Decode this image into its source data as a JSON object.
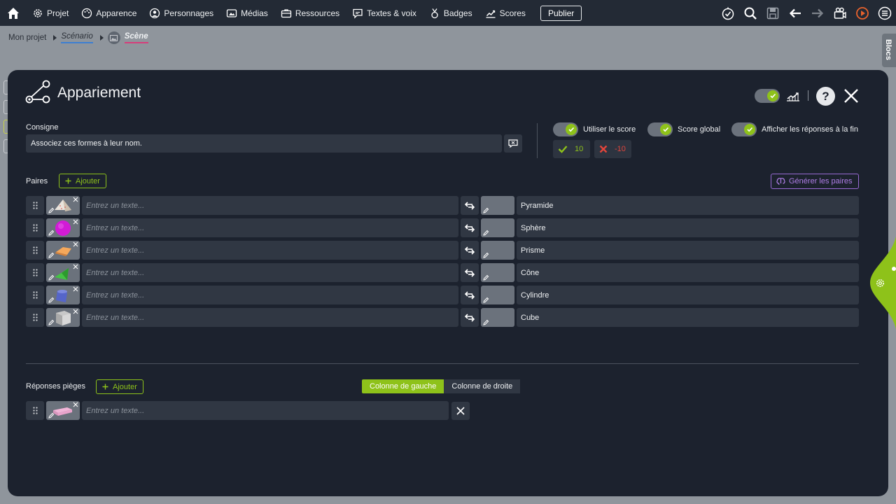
{
  "nav": {
    "items": [
      {
        "label": "Projet",
        "icon": "gear-icon"
      },
      {
        "label": "Apparence",
        "icon": "palette-icon"
      },
      {
        "label": "Personnages",
        "icon": "person-icon"
      },
      {
        "label": "Médias",
        "icon": "media-icon"
      },
      {
        "label": "Ressources",
        "icon": "briefcase-icon"
      },
      {
        "label": "Textes & voix",
        "icon": "speech-icon"
      },
      {
        "label": "Badges",
        "icon": "badge-icon"
      },
      {
        "label": "Scores",
        "icon": "chart-icon"
      }
    ],
    "publish": "Publier"
  },
  "breadcrumb": {
    "project": "Mon projet",
    "scenario": "Scénario",
    "scene": "Scène"
  },
  "side": {
    "blocs": "Blocs"
  },
  "modal": {
    "title": "Appariement",
    "help": "?",
    "consigne_label": "Consigne",
    "consigne_value": "Associez ces formes à leur nom.",
    "options": {
      "use_score": "Utiliser le score",
      "global_score": "Score global",
      "show_answers": "Afficher les réponses à la fin"
    },
    "score_correct": "10",
    "score_wrong": "-10",
    "pairs_label": "Paires",
    "add_label": "Ajouter",
    "generate_label": "Générer les paires",
    "placeholder": "Entrez un texte...",
    "pairs": [
      {
        "right": "Pyramide",
        "shape": "pyramid"
      },
      {
        "right": "Sphère",
        "shape": "sphere"
      },
      {
        "right": "Prisme",
        "shape": "prism"
      },
      {
        "right": "Cône",
        "shape": "cone"
      },
      {
        "right": "Cylindre",
        "shape": "cylinder"
      },
      {
        "right": "Cube",
        "shape": "cube"
      }
    ],
    "traps_label": "Réponses pièges",
    "traps_add": "Ajouter",
    "col_left": "Colonne de gauche",
    "col_right": "Colonne de droite"
  },
  "colors": {
    "accent": "#8ec21a",
    "modal_bg": "#1c222e",
    "field": "#303743",
    "purple": "#9a6bd6",
    "error": "#e2453b"
  }
}
